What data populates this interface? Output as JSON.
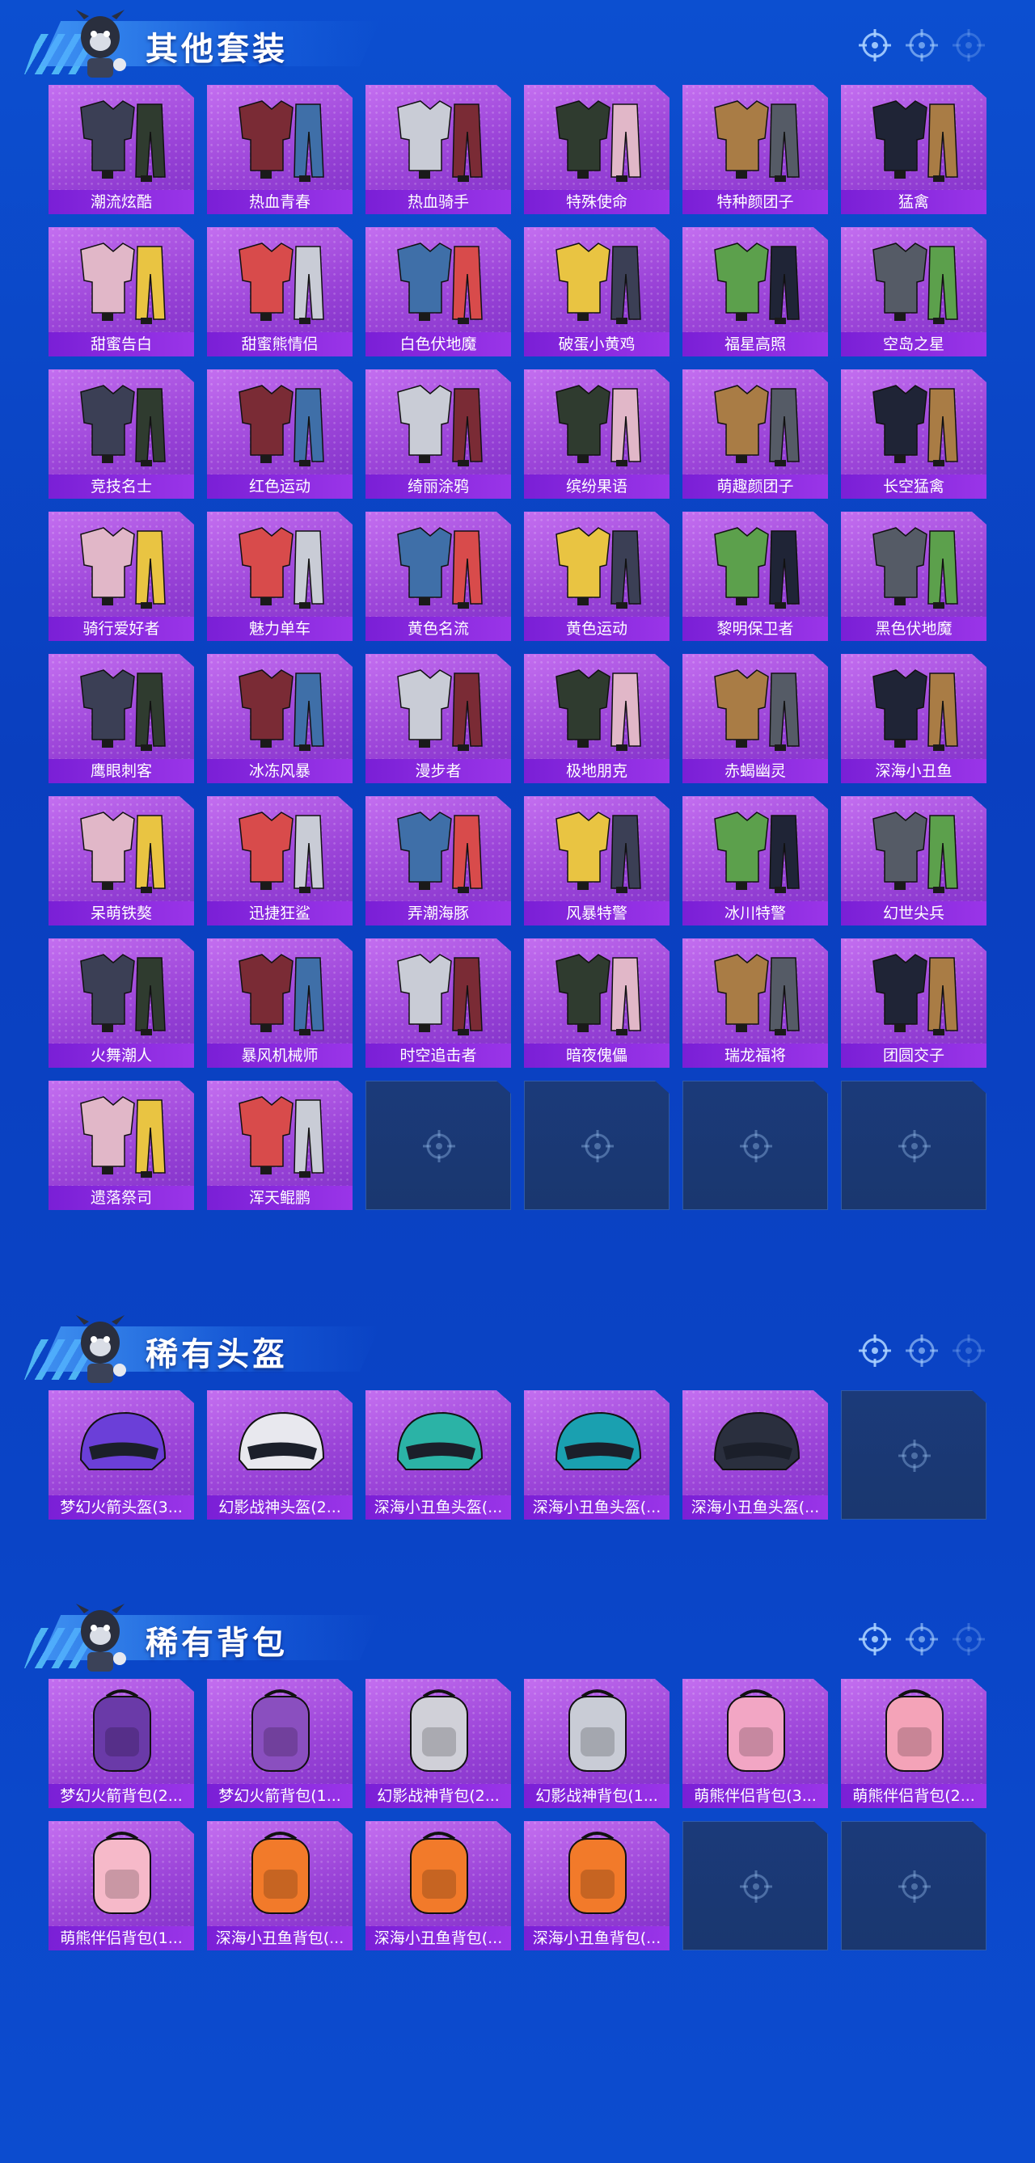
{
  "sections": [
    {
      "title": "其他套装",
      "items": [
        "潮流炫酷",
        "热血青春",
        "热血骑手",
        "特殊使命",
        "特种颜团子",
        "猛禽",
        "甜蜜告白",
        "甜蜜熊情侣",
        "白色伏地魔",
        "破蛋小黄鸡",
        "福星高照",
        "空岛之星",
        "竞技名士",
        "红色运动",
        "绮丽涂鸦",
        "缤纷果语",
        "萌趣颜团子",
        "长空猛禽",
        "骑行爱好者",
        "魅力单车",
        "黄色名流",
        "黄色运动",
        "黎明保卫者",
        "黑色伏地魔",
        "鹰眼刺客",
        "冰冻风暴",
        "漫步者",
        "极地朋克",
        "赤蝎幽灵",
        "深海小丑鱼",
        "呆萌铁獒",
        "迅捷狂鲨",
        "弄潮海豚",
        "风暴特警",
        "冰川特警",
        "幻世尖兵",
        "火舞潮人",
        "暴风机械师",
        "时空追击者",
        "暗夜傀儡",
        "瑞龙福将",
        "团圆交子",
        "遗落祭司",
        "浑天鲲鹏"
      ],
      "empty_slots": 4
    },
    {
      "title": "稀有头盔",
      "items": [
        "梦幻火箭头盔(3...",
        "幻影战神头盔(2...",
        "深海小丑鱼头盔(...",
        "深海小丑鱼头盔(...",
        "深海小丑鱼头盔(..."
      ],
      "empty_slots": 1
    },
    {
      "title": "稀有背包",
      "items": [
        "梦幻火箭背包(2...",
        "梦幻火箭背包(1...",
        "幻影战神背包(2...",
        "幻影战神背包(1...",
        "萌熊伴侣背包(3...",
        "萌熊伴侣背包(2...",
        "萌熊伴侣背包(1...",
        "深海小丑鱼背包(...",
        "深海小丑鱼背包(...",
        "深海小丑鱼背包(..."
      ],
      "empty_slots": 2
    }
  ],
  "icons": {
    "header_mascot": "mascot-icon",
    "section_markers": "crosshair-icon",
    "empty_slot": "crosshair-emblem-icon"
  },
  "colors": {
    "background": "#0c4fd0",
    "card": "#a44fe0",
    "label_bar": "#8a2ae0",
    "empty_card": "#1b3a7a"
  }
}
